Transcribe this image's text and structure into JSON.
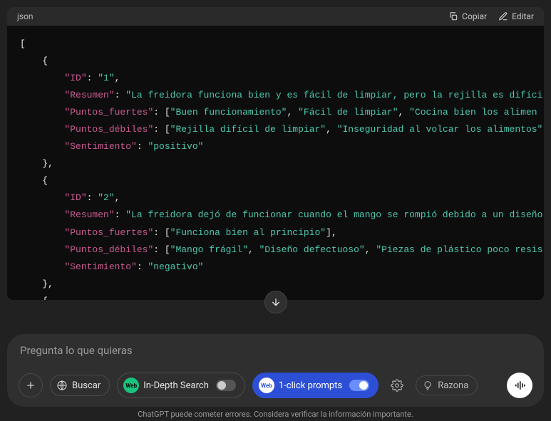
{
  "code": {
    "language": "json",
    "actions": {
      "copy": "Copiar",
      "edit": "Editar"
    },
    "lines": [
      [
        {
          "c": "b",
          "t": "["
        }
      ],
      [
        {
          "c": "b",
          "t": "    {"
        }
      ],
      [
        {
          "c": "b",
          "t": "        "
        },
        {
          "c": "k",
          "t": "\"ID\""
        },
        {
          "c": "c",
          "t": ": "
        },
        {
          "c": "s",
          "t": "\"1\""
        },
        {
          "c": "c",
          "t": ","
        }
      ],
      [
        {
          "c": "b",
          "t": "        "
        },
        {
          "c": "k",
          "t": "\"Resumen\""
        },
        {
          "c": "c",
          "t": ": "
        },
        {
          "c": "s",
          "t": "\"La freidora funciona bien y es fácil de limpiar, pero la rejilla es difíci"
        }
      ],
      [
        {
          "c": "b",
          "t": "        "
        },
        {
          "c": "k",
          "t": "\"Puntos_fuertes\""
        },
        {
          "c": "c",
          "t": ": ["
        },
        {
          "c": "s",
          "t": "\"Buen funcionamiento\""
        },
        {
          "c": "c",
          "t": ", "
        },
        {
          "c": "s",
          "t": "\"Fácil de limpiar\""
        },
        {
          "c": "c",
          "t": ", "
        },
        {
          "c": "s",
          "t": "\"Cocina bien los alimen"
        }
      ],
      [
        {
          "c": "b",
          "t": "        "
        },
        {
          "c": "k",
          "t": "\"Puntos_débiles\""
        },
        {
          "c": "c",
          "t": ": ["
        },
        {
          "c": "s",
          "t": "\"Rejilla difícil de limpiar\""
        },
        {
          "c": "c",
          "t": ", "
        },
        {
          "c": "s",
          "t": "\"Inseguridad al volcar los alimentos\""
        }
      ],
      [
        {
          "c": "b",
          "t": "        "
        },
        {
          "c": "k",
          "t": "\"Sentimiento\""
        },
        {
          "c": "c",
          "t": ": "
        },
        {
          "c": "s",
          "t": "\"positivo\""
        }
      ],
      [
        {
          "c": "b",
          "t": "    },"
        }
      ],
      [
        {
          "c": "b",
          "t": "    {"
        }
      ],
      [
        {
          "c": "b",
          "t": "        "
        },
        {
          "c": "k",
          "t": "\"ID\""
        },
        {
          "c": "c",
          "t": ": "
        },
        {
          "c": "s",
          "t": "\"2\""
        },
        {
          "c": "c",
          "t": ","
        }
      ],
      [
        {
          "c": "b",
          "t": "        "
        },
        {
          "c": "k",
          "t": "\"Resumen\""
        },
        {
          "c": "c",
          "t": ": "
        },
        {
          "c": "s",
          "t": "\"La freidora dejó de funcionar cuando el mango se rompió debido a un diseño"
        }
      ],
      [
        {
          "c": "b",
          "t": "        "
        },
        {
          "c": "k",
          "t": "\"Puntos_fuertes\""
        },
        {
          "c": "c",
          "t": ": ["
        },
        {
          "c": "s",
          "t": "\"Funciona bien al principio\""
        },
        {
          "c": "c",
          "t": "],"
        }
      ],
      [
        {
          "c": "b",
          "t": "        "
        },
        {
          "c": "k",
          "t": "\"Puntos_débiles\""
        },
        {
          "c": "c",
          "t": ": ["
        },
        {
          "c": "s",
          "t": "\"Mango frágil\""
        },
        {
          "c": "c",
          "t": ", "
        },
        {
          "c": "s",
          "t": "\"Diseño defectuoso\""
        },
        {
          "c": "c",
          "t": ", "
        },
        {
          "c": "s",
          "t": "\"Piezas de plástico poco resis"
        }
      ],
      [
        {
          "c": "b",
          "t": "        "
        },
        {
          "c": "k",
          "t": "\"Sentimiento\""
        },
        {
          "c": "c",
          "t": ": "
        },
        {
          "c": "s",
          "t": "\"negativo\""
        }
      ],
      [
        {
          "c": "b",
          "t": "    },"
        }
      ],
      [
        {
          "c": "b",
          "t": "    {"
        }
      ]
    ]
  },
  "input": {
    "placeholder": "Pregunta lo que quieras",
    "search_label": "Buscar",
    "indepth_label": "In-Depth Search",
    "oneclick_label": "1-click prompts",
    "reason_label": "Razona"
  },
  "disclaimer": "ChatGPT puede cometer errores. Considera verificar la información importante."
}
